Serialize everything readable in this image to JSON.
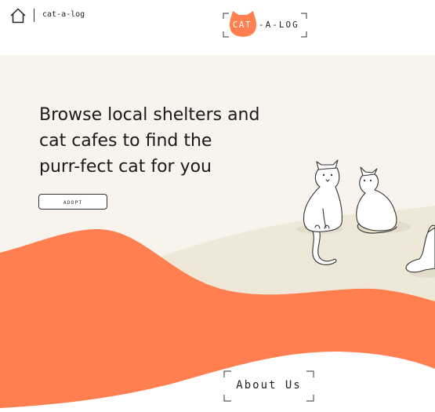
{
  "header": {
    "site_name": "cat-a-log",
    "logo": {
      "badge_text": "CAT",
      "rest_text": "-A-LOG"
    },
    "icons": {
      "home": "home-icon"
    }
  },
  "hero": {
    "headline_lines": [
      "Browse local shelters and",
      "cat cafes to find the",
      "purr-fect cat for you"
    ],
    "adopt_button": "ADOPT",
    "illustration": "cats-illustration"
  },
  "about": {
    "label": "About Us"
  },
  "colors": {
    "accent": "#ff7f50",
    "hero_background": "#f8f4ed",
    "hill": "#efe8d8",
    "shadow": "#e4dccb",
    "ink": "#1f1f1f"
  }
}
